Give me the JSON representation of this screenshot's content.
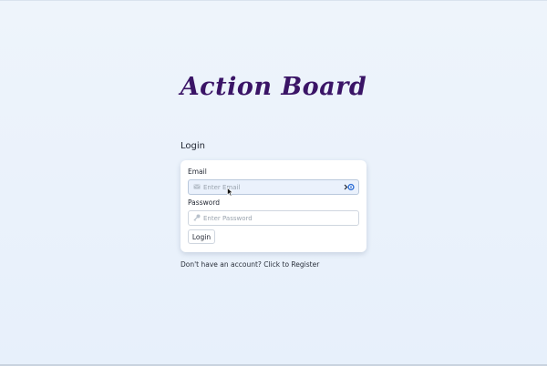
{
  "app": {
    "brand": "Action Board"
  },
  "login": {
    "title": "Login",
    "email_label": "Email",
    "email_placeholder": "Enter Email",
    "email_value": "",
    "password_label": "Password",
    "password_placeholder": "Enter Password",
    "password_value": "",
    "submit_label": "Login",
    "register_text": "Don't have an account? Click to Register"
  },
  "icons": {
    "email": "envelope-icon",
    "password": "key-icon",
    "password_manager": "password-manager-icon",
    "cursor": "mouse-pointer-icon"
  },
  "colors": {
    "background": "#e9f1fb",
    "brand": "#3a1466",
    "card": "#ffffff",
    "accent": "#2f6fd6"
  }
}
